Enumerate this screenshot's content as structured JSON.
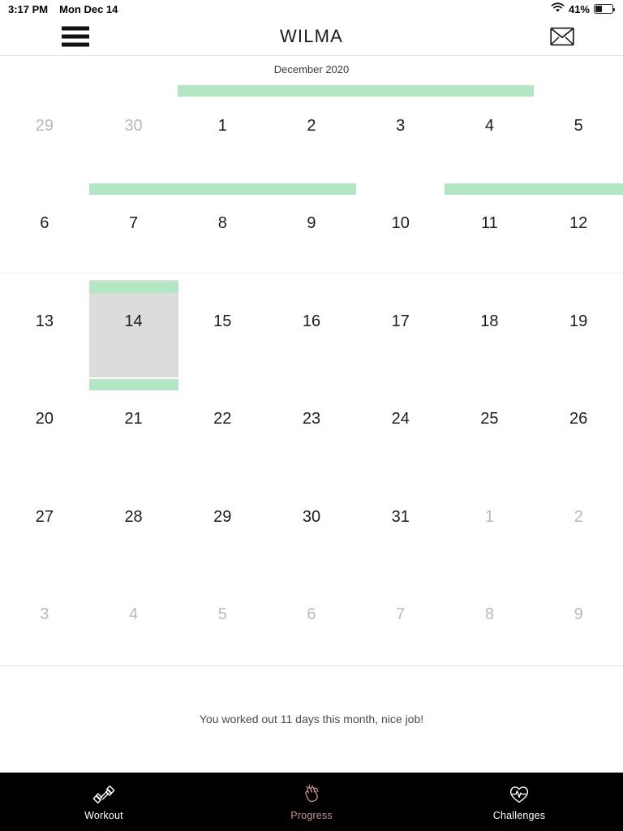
{
  "status_bar": {
    "time": "3:17 PM",
    "date": "Mon Dec 14",
    "battery_percent": "41%",
    "battery_level": 41,
    "wifi_icon": "wifi-icon",
    "battery_icon": "battery-icon"
  },
  "header": {
    "menu_icon": "hamburger-menu-icon",
    "title": "WILMA",
    "mail_icon": "envelope-icon"
  },
  "calendar": {
    "month_label": "December 2020",
    "selected_day": "14",
    "accent_color": "#b3e6c2",
    "selected_bg": "#dcdcdc",
    "weeks": [
      [
        {
          "label": "29",
          "muted": true,
          "workout": false
        },
        {
          "label": "30",
          "muted": true,
          "workout": false
        },
        {
          "label": "1",
          "muted": false,
          "workout": true
        },
        {
          "label": "2",
          "muted": false,
          "workout": true
        },
        {
          "label": "3",
          "muted": false,
          "workout": true
        },
        {
          "label": "4",
          "muted": false,
          "workout": true
        },
        {
          "label": "5",
          "muted": false,
          "workout": false
        }
      ],
      [
        {
          "label": "6",
          "muted": false,
          "workout": false
        },
        {
          "label": "7",
          "muted": false,
          "workout": true
        },
        {
          "label": "8",
          "muted": false,
          "workout": true
        },
        {
          "label": "9",
          "muted": false,
          "workout": true
        },
        {
          "label": "10",
          "muted": false,
          "workout": false
        },
        {
          "label": "11",
          "muted": false,
          "workout": true
        },
        {
          "label": "12",
          "muted": false,
          "workout": true
        }
      ],
      [
        {
          "label": "13",
          "muted": false,
          "workout": false
        },
        {
          "label": "14",
          "muted": false,
          "workout": true,
          "selected": true
        },
        {
          "label": "15",
          "muted": false,
          "workout": false
        },
        {
          "label": "16",
          "muted": false,
          "workout": false
        },
        {
          "label": "17",
          "muted": false,
          "workout": false
        },
        {
          "label": "18",
          "muted": false,
          "workout": false
        },
        {
          "label": "19",
          "muted": false,
          "workout": false
        }
      ],
      [
        {
          "label": "20",
          "muted": false,
          "workout": false
        },
        {
          "label": "21",
          "muted": false,
          "workout": true
        },
        {
          "label": "22",
          "muted": false,
          "workout": false
        },
        {
          "label": "23",
          "muted": false,
          "workout": false
        },
        {
          "label": "24",
          "muted": false,
          "workout": false
        },
        {
          "label": "25",
          "muted": false,
          "workout": false
        },
        {
          "label": "26",
          "muted": false,
          "workout": false
        }
      ],
      [
        {
          "label": "27",
          "muted": false,
          "workout": false
        },
        {
          "label": "28",
          "muted": false,
          "workout": false
        },
        {
          "label": "29",
          "muted": false,
          "workout": false
        },
        {
          "label": "30",
          "muted": false,
          "workout": false
        },
        {
          "label": "31",
          "muted": false,
          "workout": false
        },
        {
          "label": "1",
          "muted": true,
          "workout": false
        },
        {
          "label": "2",
          "muted": true,
          "workout": false
        }
      ],
      [
        {
          "label": "3",
          "muted": true,
          "workout": false
        },
        {
          "label": "4",
          "muted": true,
          "workout": false
        },
        {
          "label": "5",
          "muted": true,
          "workout": false
        },
        {
          "label": "6",
          "muted": true,
          "workout": false
        },
        {
          "label": "7",
          "muted": true,
          "workout": false
        },
        {
          "label": "8",
          "muted": true,
          "workout": false
        },
        {
          "label": "9",
          "muted": true,
          "workout": false
        }
      ]
    ]
  },
  "summary": {
    "text": "You worked out 11 days this month, nice job!",
    "workout_days_count": 11
  },
  "tab_bar": {
    "active_color": "#c98f8f",
    "inactive_color": "#ffffff",
    "items": [
      {
        "label": "Workout",
        "icon": "dumbbell-icon",
        "active": false
      },
      {
        "label": "Progress",
        "icon": "clapping-hands-icon",
        "active": true
      },
      {
        "label": "Challenges",
        "icon": "heart-pulse-icon",
        "active": false
      }
    ]
  }
}
